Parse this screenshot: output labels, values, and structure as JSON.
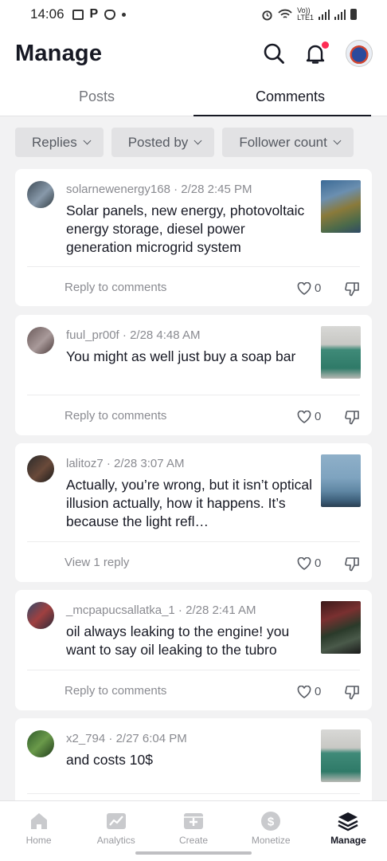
{
  "status_bar": {
    "time": "14:06",
    "network": "Vo))\nLTE1"
  },
  "header": {
    "title": "Manage"
  },
  "tabs": [
    {
      "label": "Posts",
      "active": false
    },
    {
      "label": "Comments",
      "active": true
    }
  ],
  "filters": [
    "Replies",
    "Posted by",
    "Follower count"
  ],
  "comments": [
    {
      "user": "solarnewenergy168",
      "date": "2/28 2:45 PM",
      "text": "Solar panels, new energy, photovoltaic energy storage, diesel power generation microgrid system",
      "action": "Reply to comments",
      "likes": "0"
    },
    {
      "user": "fuul_pr00f",
      "date": "2/28 4:48 AM",
      "text": "You might as well just buy a soap bar",
      "action": "Reply to comments",
      "likes": "0"
    },
    {
      "user": "lalitoz7",
      "date": "2/28 3:07 AM",
      "text": "Actually, you’re wrong, but it isn’t optical illusion actually, how it happens. It’s because the light refl…",
      "action": "View 1 reply",
      "likes": "0"
    },
    {
      "user": "_mcpapucsallatka_1",
      "date": "2/28 2:41 AM",
      "text": "oil always leaking to the engine! you want to say oil leaking to the tubro",
      "action": "Reply to comments",
      "likes": "0"
    },
    {
      "user": "x2_794",
      "date": "2/27 6:04 PM",
      "text": "and costs 10$",
      "action": "",
      "likes": ""
    }
  ],
  "bottom_nav": [
    {
      "label": "Home",
      "icon": "home-icon",
      "active": false
    },
    {
      "label": "Analytics",
      "icon": "analytics-icon",
      "active": false
    },
    {
      "label": "Create",
      "icon": "create-icon",
      "active": false
    },
    {
      "label": "Monetize",
      "icon": "monetize-icon",
      "active": false
    },
    {
      "label": "Manage",
      "icon": "manage-icon",
      "active": true
    }
  ],
  "colors": {
    "accent": "#fe2c55",
    "text": "#161823",
    "muted": "#8a8b91",
    "background": "#f2f2f3"
  }
}
